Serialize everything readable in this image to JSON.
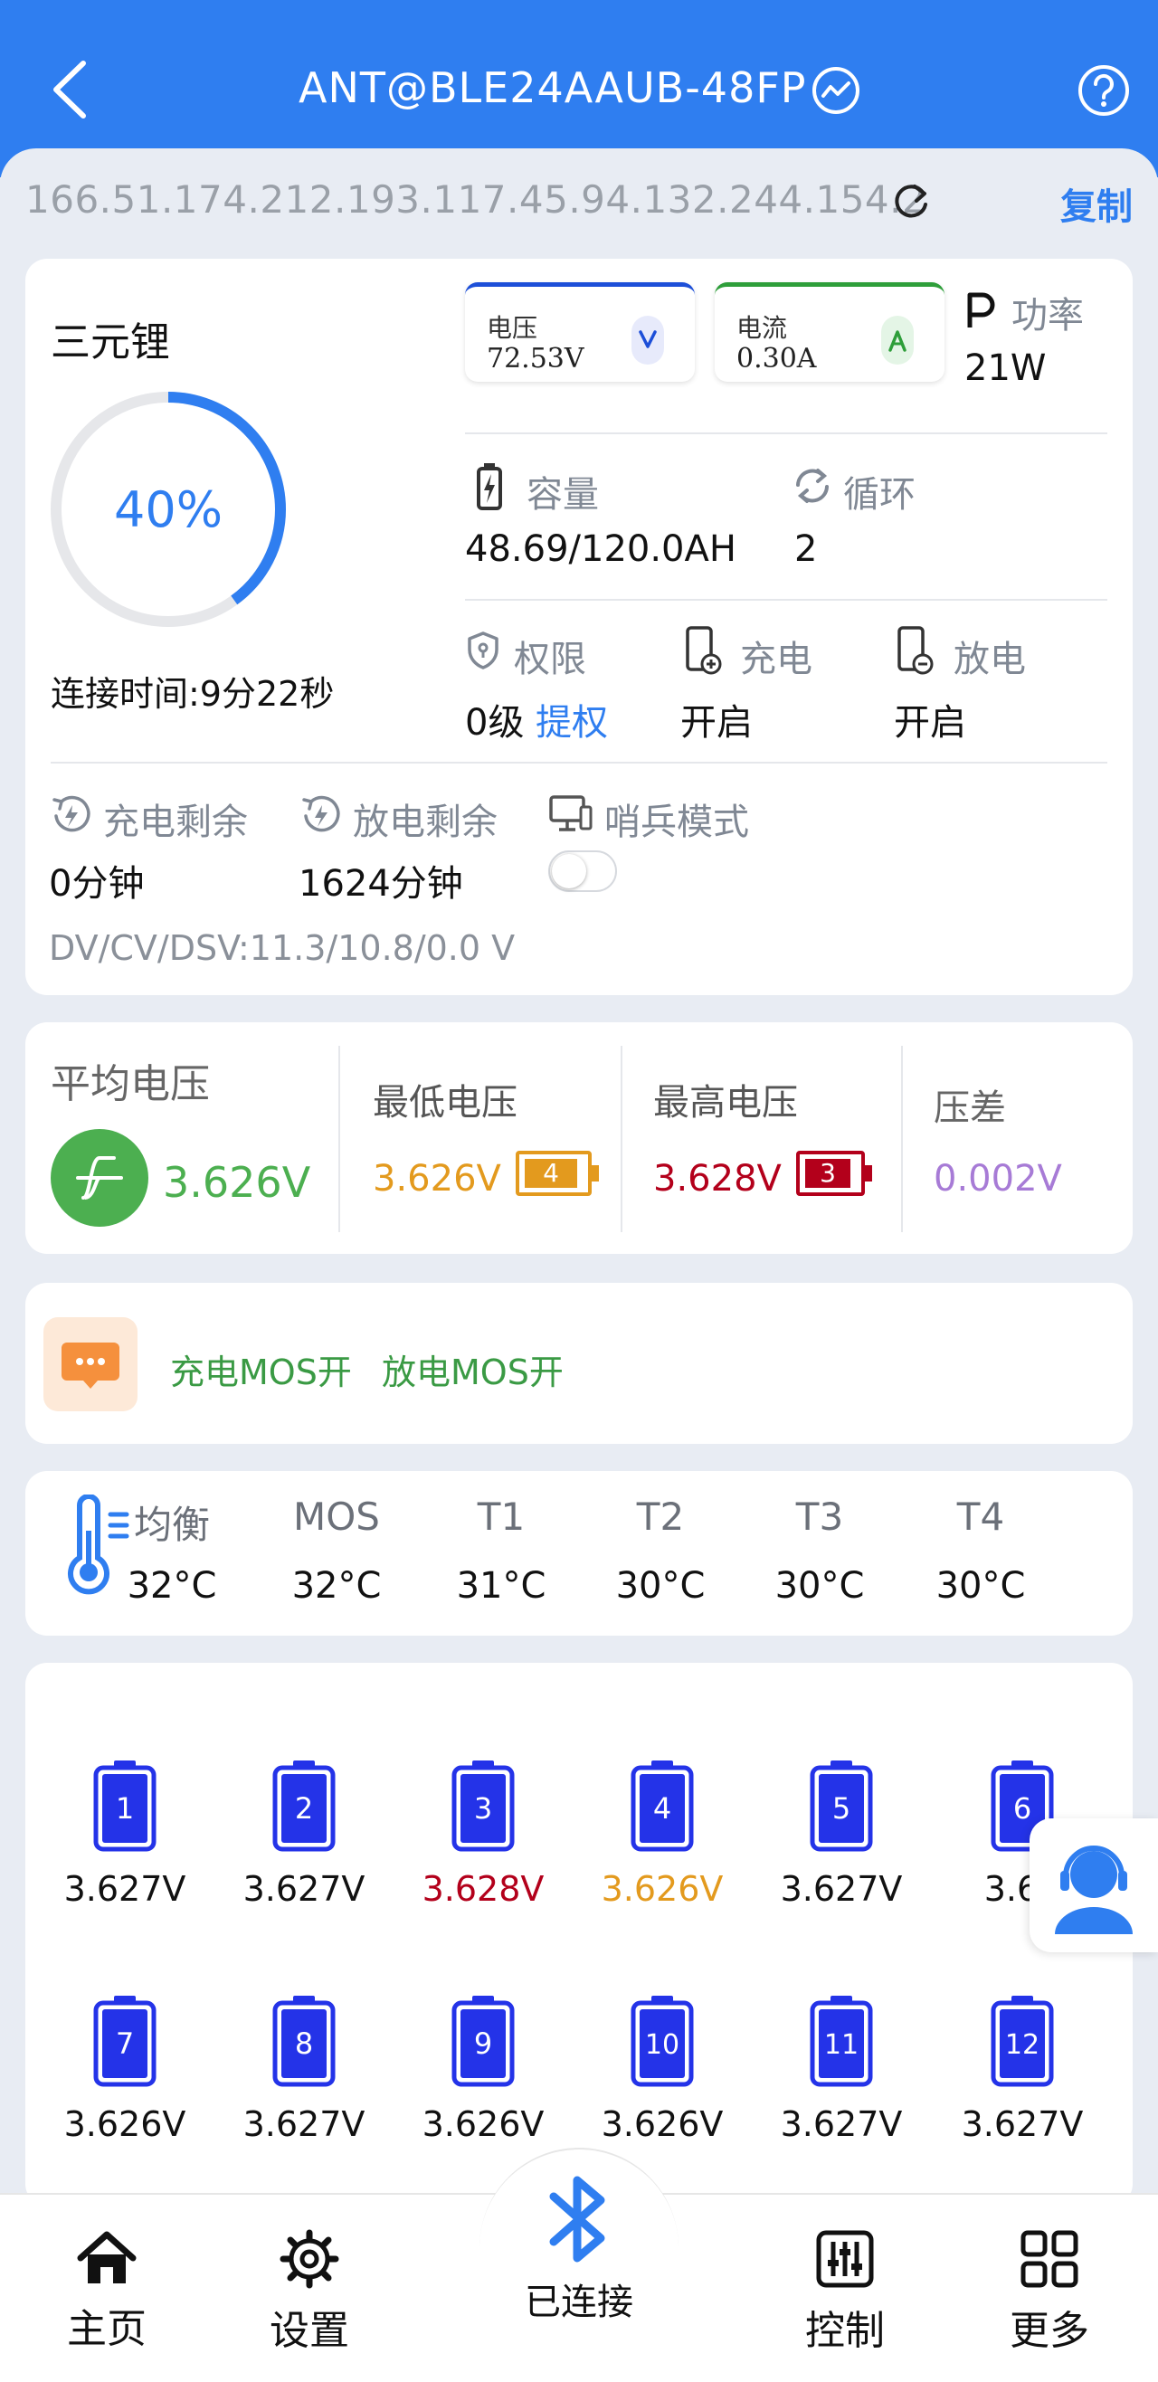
{
  "header": {
    "title": "ANT@BLE24AAUB-48FP"
  },
  "address": {
    "text": "166.51.174.212.193.117.45.94.132.244.154.2",
    "copy_label": "复制"
  },
  "summary": {
    "battery_type": "三元锂",
    "soc_text": "40%",
    "soc_fraction": 0.4,
    "connect_time": "连接时间:9分22秒",
    "voltage": {
      "label": "电压",
      "value": "72.53V"
    },
    "current": {
      "label": "电流",
      "value": "0.30A"
    },
    "power": {
      "label": "功率",
      "value": "21W"
    },
    "capacity": {
      "label": "容量",
      "value": "48.69/120.0AH"
    },
    "cycle": {
      "label": "循环",
      "value": "2"
    },
    "permission": {
      "label": "权限",
      "value": "0级",
      "link": "提权"
    },
    "charge": {
      "label": "充电",
      "value": "开启"
    },
    "discharge": {
      "label": "放电",
      "value": "开启"
    },
    "charge_remain": {
      "label": "充电剩余",
      "value": "0分钟"
    },
    "discharge_remain": {
      "label": "放电剩余",
      "value": "1624分钟"
    },
    "sentry": {
      "label": "哨兵模式",
      "on": false
    },
    "dv_line": "DV/CV/DSV:11.3/10.8/0.0 V"
  },
  "cellstats": {
    "avg": {
      "label": "平均电压",
      "value": "3.626V"
    },
    "min": {
      "label": "最低电压",
      "value": "3.626V",
      "cell": "4"
    },
    "max": {
      "label": "最高电压",
      "value": "3.628V",
      "cell": "3"
    },
    "diff": {
      "label": "压差",
      "value": "0.002V"
    }
  },
  "mos": {
    "text1": "充电MOS开",
    "text2": "放电MOS开"
  },
  "temps": [
    {
      "label": "均衡",
      "value": "32°C"
    },
    {
      "label": "MOS",
      "value": "32°C"
    },
    {
      "label": "T1",
      "value": "31°C"
    },
    {
      "label": "T2",
      "value": "30°C"
    },
    {
      "label": "T3",
      "value": "30°C"
    },
    {
      "label": "T4",
      "value": "30°C"
    }
  ],
  "cells": [
    {
      "num": "1",
      "value": "3.627V",
      "state": "normal"
    },
    {
      "num": "2",
      "value": "3.627V",
      "state": "normal"
    },
    {
      "num": "3",
      "value": "3.628V",
      "state": "max"
    },
    {
      "num": "4",
      "value": "3.626V",
      "state": "min"
    },
    {
      "num": "5",
      "value": "3.627V",
      "state": "normal"
    },
    {
      "num": "6",
      "value": "3.62",
      "state": "normal"
    },
    {
      "num": "7",
      "value": "3.626V",
      "state": "normal"
    },
    {
      "num": "8",
      "value": "3.627V",
      "state": "normal"
    },
    {
      "num": "9",
      "value": "3.626V",
      "state": "normal"
    },
    {
      "num": "10",
      "value": "3.626V",
      "state": "normal"
    },
    {
      "num": "11",
      "value": "3.627V",
      "state": "normal"
    },
    {
      "num": "12",
      "value": "3.627V",
      "state": "normal"
    }
  ],
  "nav": {
    "home": "主页",
    "settings": "设置",
    "bluetooth": "已连接",
    "control": "控制",
    "more": "更多"
  },
  "colors": {
    "brand": "#2f7ef0",
    "green": "#4caf50",
    "min_orange": "#e39a1e",
    "max_red": "#b3001b",
    "diff_purple": "#a77bd6",
    "cell_blue": "#2433e8"
  }
}
